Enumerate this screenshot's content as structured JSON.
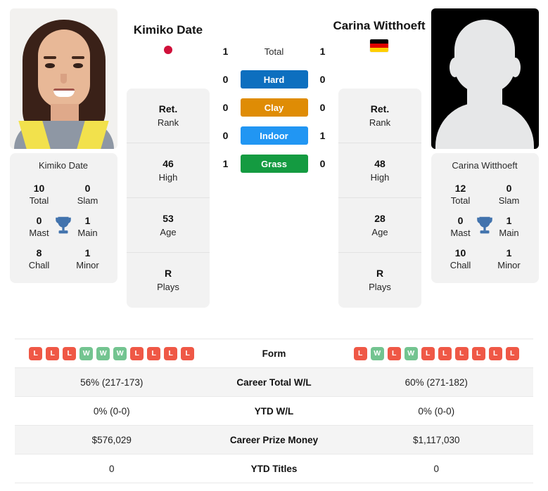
{
  "players": {
    "left": {
      "name": "Kimiko Date",
      "flag": "jp-flag-icon",
      "photo": "player-portrait",
      "titles": {
        "total": {
          "num": "10",
          "label": "Total"
        },
        "slam": {
          "num": "0",
          "label": "Slam"
        },
        "mast": {
          "num": "0",
          "label": "Mast"
        },
        "main": {
          "num": "1",
          "label": "Main"
        },
        "chall": {
          "num": "8",
          "label": "Chall"
        },
        "minor": {
          "num": "1",
          "label": "Minor"
        }
      },
      "ranking": [
        {
          "num": "Ret.",
          "label": "Rank"
        },
        {
          "num": "46",
          "label": "High"
        },
        {
          "num": "53",
          "label": "Age"
        },
        {
          "num": "R",
          "label": "Plays"
        }
      ],
      "form": [
        "L",
        "L",
        "L",
        "W",
        "W",
        "W",
        "L",
        "L",
        "L",
        "L"
      ],
      "career_total_wl": "56% (217-173)",
      "ytd_wl": "0% (0-0)",
      "career_prize_money": "$576,029",
      "ytd_titles": "0"
    },
    "right": {
      "name": "Carina Witthoeft",
      "flag": "de-flag-icon",
      "photo": "silhouette-avatar",
      "titles": {
        "total": {
          "num": "12",
          "label": "Total"
        },
        "slam": {
          "num": "0",
          "label": "Slam"
        },
        "mast": {
          "num": "0",
          "label": "Mast"
        },
        "main": {
          "num": "1",
          "label": "Main"
        },
        "chall": {
          "num": "10",
          "label": "Chall"
        },
        "minor": {
          "num": "1",
          "label": "Minor"
        }
      },
      "ranking": [
        {
          "num": "Ret.",
          "label": "Rank"
        },
        {
          "num": "48",
          "label": "High"
        },
        {
          "num": "28",
          "label": "Age"
        },
        {
          "num": "R",
          "label": "Plays"
        }
      ],
      "form": [
        "L",
        "W",
        "L",
        "W",
        "L",
        "L",
        "L",
        "L",
        "L",
        "L"
      ],
      "career_total_wl": "60% (271-182)",
      "ytd_wl": "0% (0-0)",
      "career_prize_money": "$1,117,030",
      "ytd_titles": "0"
    }
  },
  "head_to_head": [
    {
      "left": "1",
      "surface": "Total",
      "right": "1",
      "color": "none"
    },
    {
      "left": "0",
      "surface": "Hard",
      "right": "0",
      "color": "#0d6fbf"
    },
    {
      "left": "0",
      "surface": "Clay",
      "right": "0",
      "color": "#df8c05"
    },
    {
      "left": "0",
      "surface": "Indoor",
      "right": "1",
      "color": "#2196f3"
    },
    {
      "left": "1",
      "surface": "Grass",
      "right": "0",
      "color": "#149b41"
    }
  ],
  "stats_rows": [
    {
      "label": "Form",
      "type": "form"
    },
    {
      "label": "Career Total W/L",
      "type": "text",
      "key": "career_total_wl"
    },
    {
      "label": "YTD W/L",
      "type": "text",
      "key": "ytd_wl"
    },
    {
      "label": "Career Prize Money",
      "type": "text",
      "key": "career_prize_money"
    },
    {
      "label": "YTD Titles",
      "type": "text",
      "key": "ytd_titles"
    }
  ],
  "colors": {
    "hard": "#0d6fbf",
    "clay": "#df8c05",
    "indoor": "#2196f3",
    "grass": "#149b41",
    "win": "#73c490",
    "loss": "#ef5846",
    "trophy": "#4273ad"
  }
}
